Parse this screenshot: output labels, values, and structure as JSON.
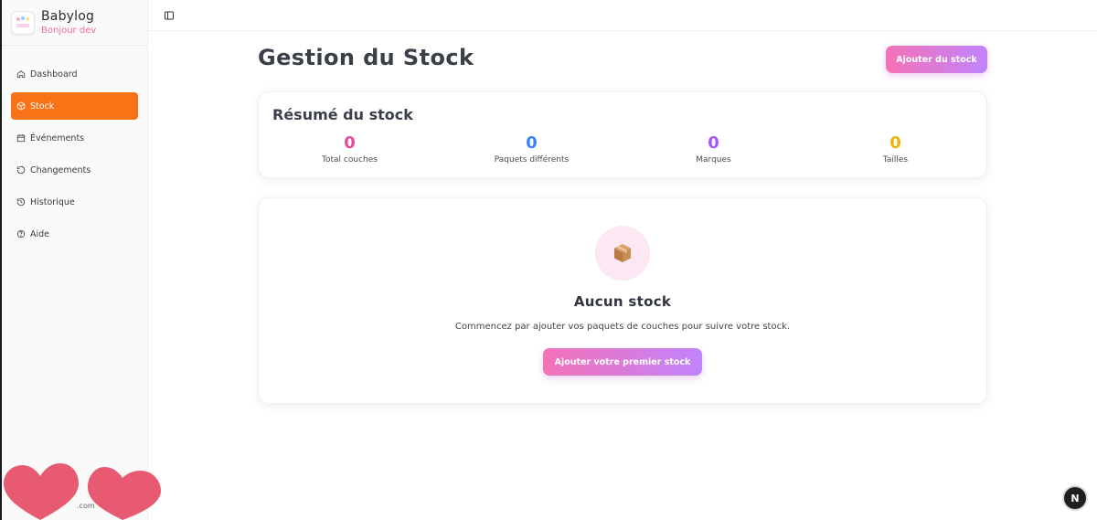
{
  "app": {
    "name": "Babylog",
    "greeting": "Bonjour dev",
    "logo_text": "Babylog"
  },
  "sidebar": {
    "items": [
      {
        "label": "Dashboard",
        "icon": "home-icon",
        "active": false
      },
      {
        "label": "Stock",
        "icon": "package-icon",
        "active": true
      },
      {
        "label": "Événements",
        "icon": "calendar-icon",
        "active": false
      },
      {
        "label": "Changements",
        "icon": "refresh-icon",
        "active": false
      },
      {
        "label": "Historique",
        "icon": "history-icon",
        "active": false
      },
      {
        "label": "Aide",
        "icon": "help-circle-icon",
        "active": false
      }
    ],
    "footer_text": ".com"
  },
  "page": {
    "title": "Gestion du Stock",
    "add_button": "Ajouter du stock"
  },
  "summary": {
    "title": "Résumé du stock",
    "stats": [
      {
        "value": "0",
        "label": "Total couches",
        "color": "#ec4899"
      },
      {
        "value": "0",
        "label": "Paquets différents",
        "color": "#3b82f6"
      },
      {
        "value": "0",
        "label": "Marques",
        "color": "#a855f7"
      },
      {
        "value": "0",
        "label": "Tailles",
        "color": "#eab308"
      }
    ]
  },
  "empty_state": {
    "icon": "box-icon",
    "title": "Aucun stock",
    "description": "Commencez par ajouter vos paquets de couches pour suivre votre stock.",
    "button": "Ajouter votre premier stock"
  },
  "colors": {
    "accent": "#f97316",
    "pink": "#f472b6",
    "purple": "#c084fc"
  },
  "badge": "N"
}
